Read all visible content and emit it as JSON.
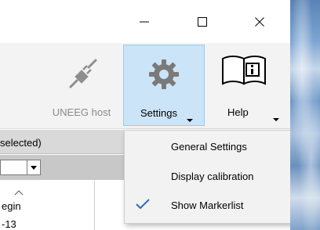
{
  "titlebar": {
    "minimize_icon": "minimize-icon",
    "maximize_icon": "maximize-icon",
    "close_icon": "close-icon"
  },
  "ribbon": {
    "uneeg_host": {
      "label": "UNEEG host",
      "icon": "unplugged-icon",
      "enabled": false
    },
    "settings": {
      "label": "Settings",
      "icon": "gear-icon",
      "pressed": true
    },
    "help": {
      "label": "Help",
      "icon": "book-info-icon"
    }
  },
  "panel": {
    "header_text": "selected)",
    "list": {
      "column_header": "egin",
      "first_value": "-13"
    }
  },
  "settings_menu": {
    "items": [
      {
        "label": "General Settings",
        "checked": false
      },
      {
        "label": "Display calibration",
        "checked": false
      },
      {
        "label": "Show Markerlist",
        "checked": true
      }
    ]
  },
  "colors": {
    "pressed_fill": "#cce4f7",
    "pressed_border": "#99c9ef",
    "check_color": "#2f6db5",
    "disabled_text": "#8a8a8a"
  }
}
